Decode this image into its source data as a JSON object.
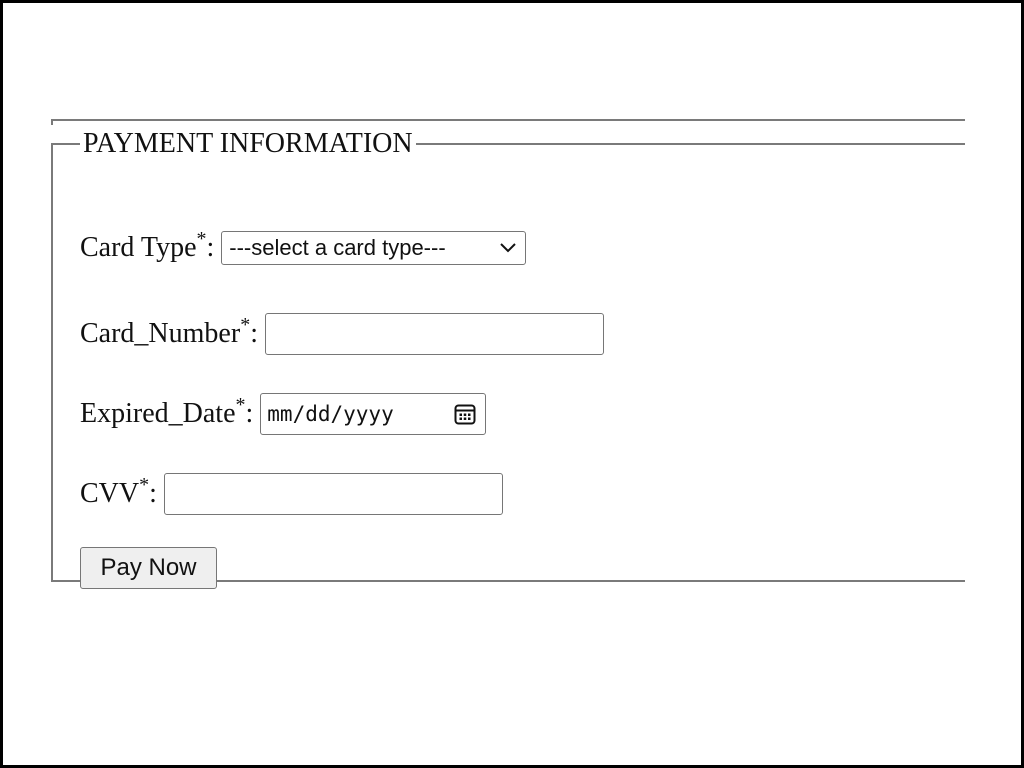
{
  "form": {
    "legend": "PAYMENT INFORMATION",
    "required_marker": "*",
    "card_type": {
      "label": "Card Type",
      "colon": ":",
      "selected": "---select a card type---"
    },
    "card_number": {
      "label": "Card_Number",
      "colon": ":",
      "value": ""
    },
    "expired_date": {
      "label": "Expired_Date",
      "colon": ":",
      "placeholder": "mm/dd/yyyy"
    },
    "cvv": {
      "label": "CVV",
      "colon": ":",
      "value": ""
    },
    "submit_label": "Pay Now"
  },
  "icons": {
    "select_arrow": "chevron-down-icon",
    "date_picker": "calendar-icon"
  }
}
